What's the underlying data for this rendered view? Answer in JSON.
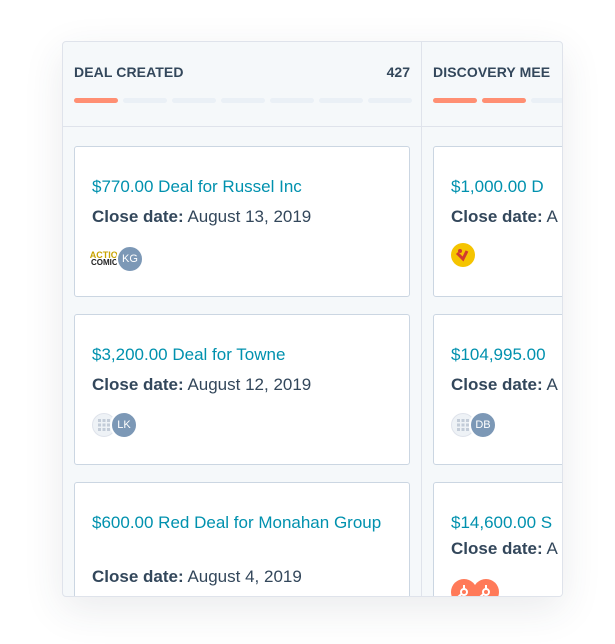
{
  "columns": [
    {
      "title": "DEAL CREATED",
      "count": "427",
      "progress_filled": 1,
      "progress_total": 7,
      "cards": [
        {
          "name": "$770.00 Deal for Russel Inc",
          "close_label": "Close date:",
          "close_date": "August 13, 2019",
          "avatar_initials": "KG",
          "company_logo": "comic-logo",
          "logo_text_top": "ACTION",
          "logo_text_bottom": "COMICS"
        },
        {
          "name": "$3,200.00 Deal for Towne",
          "close_label": "Close date:",
          "close_date": "August 12, 2019",
          "avatar_initials": "LK",
          "company_logo": "grid-logo"
        },
        {
          "name": "$600.00 Red Deal for Monahan Group",
          "close_label": "Close date:",
          "close_date": "August 4, 2019",
          "company_logo": ""
        }
      ]
    },
    {
      "title": "DISCOVERY MEE",
      "count": "",
      "progress_filled": 2,
      "progress_total": 3,
      "cards": [
        {
          "name": "$1,000.00 D",
          "close_label": "Close date:",
          "close_date": "A",
          "company_logo": "yellow-logo"
        },
        {
          "name": "$104,995.00",
          "close_label": "Close date:",
          "close_date": "A",
          "avatar_initials": "DB",
          "company_logo": "grid-logo"
        },
        {
          "name": "$14,600.00 S",
          "close_label": "Close date:",
          "close_date": "A",
          "company_logo": "hubspot-logo"
        }
      ]
    }
  ],
  "colors": {
    "accent_link": "#0091ae",
    "progress_on": "#ff8f73",
    "progress_off": "#eaf0f6",
    "text": "#33475b",
    "avatar": "#7c98b6"
  }
}
